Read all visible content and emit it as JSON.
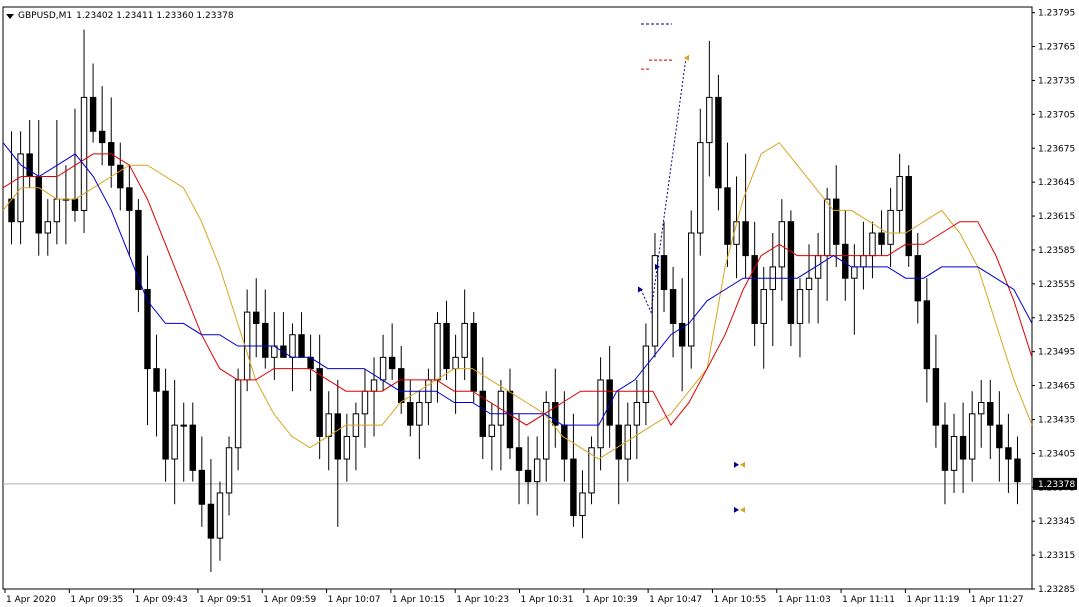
{
  "header": {
    "symbol_info": "GBPUSD,M1",
    "ohlc": "1.23402 1.23411 1.23360 1.23378"
  },
  "price_axis": {
    "labels": [
      "1.23795",
      "1.23765",
      "1.23735",
      "1.23705",
      "1.23675",
      "1.23645",
      "1.23615",
      "1.23585",
      "1.23555",
      "1.23525",
      "1.23495",
      "1.23465",
      "1.23435",
      "1.23405",
      "1.23375",
      "1.23345",
      "1.23315",
      "1.23285"
    ],
    "current_price": "1.23378"
  },
  "time_axis": {
    "labels": [
      "1 Apr 2020",
      "1 Apr 09:35",
      "1 Apr 09:43",
      "1 Apr 09:51",
      "1 Apr 09:59",
      "1 Apr 10:07",
      "1 Apr 10:15",
      "1 Apr 10:23",
      "1 Apr 10:31",
      "1 Apr 10:39",
      "1 Apr 10:47",
      "1 Apr 10:55",
      "1 Apr 11:03",
      "1 Apr 11:11",
      "1 Apr 11:19",
      "1 Apr 11:27"
    ]
  },
  "colors": {
    "ma_fast": "#daa520",
    "ma_mid": "#dd0000",
    "ma_slow": "#0000cc",
    "candle": "#000000",
    "arrow_blue": "#00008b",
    "arrow_orange": "#daa520"
  },
  "chart_data": {
    "type": "candlestick",
    "symbol": "GBPUSD",
    "timeframe": "M1",
    "ylim": [
      1.23285,
      1.238
    ],
    "current_price": 1.23378,
    "ohlc": [
      [
        1.2363,
        1.2369,
        1.2359,
        1.2361
      ],
      [
        1.2361,
        1.2369,
        1.2359,
        1.2367
      ],
      [
        1.2367,
        1.237,
        1.2364,
        1.2365
      ],
      [
        1.2365,
        1.237,
        1.2358,
        1.236
      ],
      [
        1.236,
        1.2363,
        1.2358,
        1.2361
      ],
      [
        1.2361,
        1.237,
        1.2359,
        1.2363
      ],
      [
        1.2363,
        1.2366,
        1.2359,
        1.2363
      ],
      [
        1.2363,
        1.2371,
        1.2361,
        1.2362
      ],
      [
        1.2362,
        1.2378,
        1.236,
        1.2372
      ],
      [
        1.2372,
        1.2375,
        1.2368,
        1.2369
      ],
      [
        1.2369,
        1.2373,
        1.2366,
        1.2368
      ],
      [
        1.2368,
        1.2372,
        1.2364,
        1.2366
      ],
      [
        1.2366,
        1.2368,
        1.2362,
        1.2364
      ],
      [
        1.2364,
        1.2366,
        1.2358,
        1.2362
      ],
      [
        1.2362,
        1.2363,
        1.2353,
        1.2355
      ],
      [
        1.2355,
        1.2358,
        1.2343,
        1.2348
      ],
      [
        1.2348,
        1.2351,
        1.2342,
        1.2346
      ],
      [
        1.2346,
        1.2348,
        1.2338,
        1.234
      ],
      [
        1.234,
        1.2347,
        1.2336,
        1.2343
      ],
      [
        1.2343,
        1.2345,
        1.2338,
        1.2343
      ],
      [
        1.2343,
        1.2345,
        1.2338,
        1.2339
      ],
      [
        1.2339,
        1.2342,
        1.2334,
        1.2336
      ],
      [
        1.2336,
        1.234,
        1.233,
        1.2333
      ],
      [
        1.2333,
        1.2338,
        1.2331,
        1.2337
      ],
      [
        1.2337,
        1.2342,
        1.2335,
        1.2341
      ],
      [
        1.2341,
        1.2348,
        1.2339,
        1.2347
      ],
      [
        1.2347,
        1.2355,
        1.2346,
        1.2353
      ],
      [
        1.2353,
        1.2356,
        1.2349,
        1.2352
      ],
      [
        1.2352,
        1.2355,
        1.2348,
        1.2349
      ],
      [
        1.2349,
        1.2353,
        1.2347,
        1.235
      ],
      [
        1.235,
        1.2353,
        1.2349,
        1.2349
      ],
      [
        1.2349,
        1.2352,
        1.2346,
        1.2351
      ],
      [
        1.2351,
        1.2353,
        1.2349,
        1.2349
      ],
      [
        1.2349,
        1.2351,
        1.2346,
        1.2348
      ],
      [
        1.2348,
        1.2351,
        1.234,
        1.2342
      ],
      [
        1.2342,
        1.2346,
        1.2339,
        1.2344
      ],
      [
        1.2344,
        1.2347,
        1.2334,
        1.234
      ],
      [
        1.234,
        1.2344,
        1.2338,
        1.2342
      ],
      [
        1.2342,
        1.2345,
        1.2339,
        1.2344
      ],
      [
        1.2344,
        1.2348,
        1.2341,
        1.2346
      ],
      [
        1.2346,
        1.2349,
        1.2342,
        1.2347
      ],
      [
        1.2347,
        1.2351,
        1.2346,
        1.2349
      ],
      [
        1.2349,
        1.2352,
        1.2347,
        1.2348
      ],
      [
        1.2348,
        1.235,
        1.2344,
        1.2345
      ],
      [
        1.2345,
        1.2347,
        1.2342,
        1.2343
      ],
      [
        1.2343,
        1.2346,
        1.234,
        1.2345
      ],
      [
        1.2345,
        1.2348,
        1.2343,
        1.2347
      ],
      [
        1.2347,
        1.2353,
        1.2345,
        1.2352
      ],
      [
        1.2352,
        1.2354,
        1.2347,
        1.2348
      ],
      [
        1.2348,
        1.2351,
        1.2344,
        1.2349
      ],
      [
        1.2349,
        1.2355,
        1.2347,
        1.2352
      ],
      [
        1.2352,
        1.2353,
        1.2345,
        1.2346
      ],
      [
        1.2346,
        1.2349,
        1.234,
        1.2342
      ],
      [
        1.2342,
        1.2345,
        1.2339,
        1.2343
      ],
      [
        1.2343,
        1.2347,
        1.2339,
        1.2346
      ],
      [
        1.2346,
        1.2348,
        1.234,
        1.2341
      ],
      [
        1.2341,
        1.2344,
        1.2336,
        1.2339
      ],
      [
        1.2339,
        1.2342,
        1.2336,
        1.2338
      ],
      [
        1.2338,
        1.2342,
        1.2335,
        1.234
      ],
      [
        1.234,
        1.2346,
        1.2338,
        1.2345
      ],
      [
        1.2345,
        1.2348,
        1.2341,
        1.2343
      ],
      [
        1.2343,
        1.2346,
        1.2338,
        1.234
      ],
      [
        1.234,
        1.2344,
        1.2334,
        1.2335
      ],
      [
        1.2335,
        1.2339,
        1.2333,
        1.2337
      ],
      [
        1.2337,
        1.2342,
        1.2336,
        1.2341
      ],
      [
        1.2341,
        1.2349,
        1.2339,
        1.2347
      ],
      [
        1.2347,
        1.235,
        1.2341,
        1.2343
      ],
      [
        1.2343,
        1.2346,
        1.2336,
        1.234
      ],
      [
        1.234,
        1.2345,
        1.2338,
        1.2343
      ],
      [
        1.2343,
        1.2347,
        1.234,
        1.2345
      ],
      [
        1.2345,
        1.2352,
        1.2343,
        1.235
      ],
      [
        1.235,
        1.236,
        1.2349,
        1.2358
      ],
      [
        1.2358,
        1.2361,
        1.2353,
        1.2355
      ],
      [
        1.2355,
        1.2357,
        1.2349,
        1.2352
      ],
      [
        1.2352,
        1.2356,
        1.2346,
        1.235
      ],
      [
        1.235,
        1.2362,
        1.2348,
        1.236
      ],
      [
        1.236,
        1.2371,
        1.2358,
        1.2368
      ],
      [
        1.2368,
        1.2377,
        1.2365,
        1.2372
      ],
      [
        1.2372,
        1.2374,
        1.2362,
        1.2364
      ],
      [
        1.2364,
        1.2368,
        1.2357,
        1.2359
      ],
      [
        1.2359,
        1.2365,
        1.2356,
        1.2361
      ],
      [
        1.2361,
        1.2367,
        1.2356,
        1.2358
      ],
      [
        1.2358,
        1.2361,
        1.235,
        1.2352
      ],
      [
        1.2352,
        1.2357,
        1.2348,
        1.2355
      ],
      [
        1.2355,
        1.236,
        1.235,
        1.2357
      ],
      [
        1.2357,
        1.2363,
        1.2354,
        1.2361
      ],
      [
        1.2361,
        1.2362,
        1.235,
        1.2352
      ],
      [
        1.2352,
        1.2356,
        1.2349,
        1.2355
      ],
      [
        1.2355,
        1.2359,
        1.2352,
        1.2356
      ],
      [
        1.2356,
        1.236,
        1.2352,
        1.2358
      ],
      [
        1.2358,
        1.2364,
        1.2354,
        1.2363
      ],
      [
        1.2363,
        1.2366,
        1.2357,
        1.2359
      ],
      [
        1.2359,
        1.2362,
        1.2354,
        1.2356
      ],
      [
        1.2356,
        1.2359,
        1.2351,
        1.2357
      ],
      [
        1.2357,
        1.2361,
        1.2355,
        1.2358
      ],
      [
        1.2358,
        1.2361,
        1.2356,
        1.236
      ],
      [
        1.236,
        1.2362,
        1.2358,
        1.2359
      ],
      [
        1.2359,
        1.2364,
        1.2357,
        1.2362
      ],
      [
        1.2362,
        1.2367,
        1.236,
        1.2365
      ],
      [
        1.2365,
        1.2366,
        1.2357,
        1.2358
      ],
      [
        1.2358,
        1.236,
        1.2352,
        1.2354
      ],
      [
        1.2354,
        1.2356,
        1.2345,
        1.2348
      ],
      [
        1.2348,
        1.2351,
        1.2341,
        1.2343
      ],
      [
        1.2343,
        1.2345,
        1.2336,
        1.2339
      ],
      [
        1.2339,
        1.2344,
        1.2337,
        1.2342
      ],
      [
        1.2342,
        1.2345,
        1.2337,
        1.234
      ],
      [
        1.234,
        1.2346,
        1.2338,
        1.2344
      ],
      [
        1.2344,
        1.2347,
        1.2341,
        1.2345
      ],
      [
        1.2345,
        1.2347,
        1.234,
        1.2343
      ],
      [
        1.2343,
        1.2346,
        1.2338,
        1.2341
      ],
      [
        1.2341,
        1.2344,
        1.2337,
        1.234
      ],
      [
        1.234,
        1.2342,
        1.2336,
        1.2338
      ]
    ],
    "series": [
      {
        "values": [
          1.2362,
          1.2364,
          1.2364,
          1.2363,
          1.2363,
          1.2364,
          1.2365,
          1.2366,
          1.2366,
          1.2365,
          1.2364,
          1.2361,
          1.2357,
          1.2352,
          1.2347,
          1.2344,
          1.2342,
          1.2341,
          1.2342,
          1.2343,
          1.2343,
          1.2343,
          1.2345,
          1.2346,
          1.2347,
          1.2348,
          1.2348,
          1.2347,
          1.2346,
          1.2345,
          1.2344,
          1.2342,
          1.2341,
          1.234,
          1.2341,
          1.2342,
          1.2343,
          1.2344,
          1.2346,
          1.2348,
          1.2357,
          1.2363,
          1.2367,
          1.2368,
          1.2366,
          1.2364,
          1.2362,
          1.2362,
          1.2361,
          1.236,
          1.236,
          1.2361,
          1.2362,
          1.236,
          1.2357,
          1.2352,
          1.2347,
          1.2343
        ]
      },
      {
        "values": [
          1.2364,
          1.2365,
          1.2365,
          1.2365,
          1.2366,
          1.2367,
          1.2367,
          1.2366,
          1.2363,
          1.2359,
          1.2355,
          1.2351,
          1.2348,
          1.2347,
          1.2347,
          1.2348,
          1.2348,
          1.2348,
          1.2347,
          1.2346,
          1.2346,
          1.2346,
          1.2347,
          1.2347,
          1.2347,
          1.2346,
          1.2346,
          1.2345,
          1.2344,
          1.2343,
          1.2344,
          1.2345,
          1.2346,
          1.2346,
          1.2346,
          1.2346,
          1.2346,
          1.2343,
          1.2345,
          1.2348,
          1.2351,
          1.2355,
          1.2358,
          1.2359,
          1.2358,
          1.2358,
          1.2358,
          1.2358,
          1.2358,
          1.2358,
          1.2359,
          1.2359,
          1.236,
          1.2361,
          1.2361,
          1.2358,
          1.2354,
          1.2349
        ]
      },
      {
        "values": [
          1.2368,
          1.2366,
          1.2365,
          1.2366,
          1.2367,
          1.2365,
          1.2362,
          1.2358,
          1.2354,
          1.2352,
          1.2352,
          1.2351,
          1.2351,
          1.235,
          1.235,
          1.235,
          1.2349,
          1.2349,
          1.2348,
          1.2348,
          1.2348,
          1.2347,
          1.2346,
          1.2346,
          1.2346,
          1.2345,
          1.2345,
          1.2344,
          1.2344,
          1.2344,
          1.2344,
          1.2343,
          1.2343,
          1.2343,
          1.2346,
          1.2347,
          1.2349,
          1.2351,
          1.2352,
          1.2354,
          1.2355,
          1.2356,
          1.2356,
          1.2356,
          1.2356,
          1.2357,
          1.2358,
          1.2357,
          1.2357,
          1.2357,
          1.2356,
          1.2356,
          1.2357,
          1.2357,
          1.2357,
          1.2356,
          1.2355,
          1.2352
        ]
      }
    ],
    "arrows": [
      {
        "price": 1.2355,
        "color": "blue"
      },
      {
        "price": 1.2357,
        "color": "blue"
      },
      {
        "price": 1.23755,
        "color": "orange"
      },
      {
        "price": 1.23395,
        "color": "blue"
      },
      {
        "price": 1.23395,
        "color": "orange"
      },
      {
        "price": 1.23355,
        "color": "blue"
      },
      {
        "price": 1.23355,
        "color": "orange"
      }
    ],
    "dashed_levels": [
      {
        "price": 1.23785,
        "color": "navy"
      },
      {
        "price": 1.23745,
        "color": "red"
      },
      {
        "price": 1.23753,
        "color": "red"
      }
    ]
  }
}
